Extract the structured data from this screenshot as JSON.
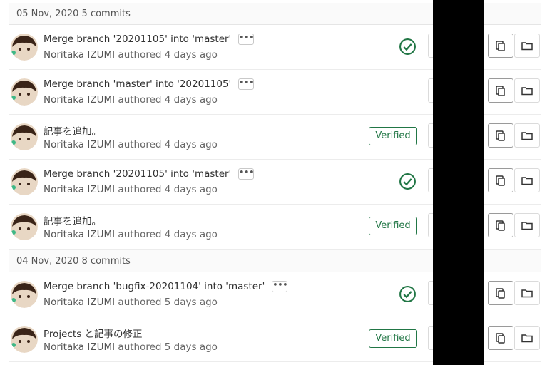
{
  "groups": [
    {
      "date_label": "05 Nov, 2020",
      "count_label": "5 commits"
    },
    {
      "date_label": "04 Nov, 2020",
      "count_label": "8 commits"
    }
  ],
  "commits": [
    {
      "title": "Merge branch '20201105' into 'master'",
      "author": "Noritaka IZUMI",
      "verb": "authored",
      "time": "4 days ago",
      "status": "check",
      "ellipsis": "•••"
    },
    {
      "title": "Merge branch 'master' into '20201105'",
      "author": "Noritaka IZUMI",
      "verb": "authored",
      "time": "4 days ago",
      "status": "none",
      "ellipsis": "•••"
    },
    {
      "title": "記事を追加。",
      "author": "Noritaka IZUMI",
      "verb": "authored",
      "time": "4 days ago",
      "status": "verified",
      "badge": "Verified"
    },
    {
      "title": "Merge branch '20201105' into 'master'",
      "author": "Noritaka IZUMI",
      "verb": "authored",
      "time": "4 days ago",
      "status": "check",
      "ellipsis": "•••"
    },
    {
      "title": "記事を追加。",
      "author": "Noritaka IZUMI",
      "verb": "authored",
      "time": "4 days ago",
      "status": "verified",
      "badge": "Verified"
    },
    {
      "title": "Merge branch 'bugfix-20201104' into 'master'",
      "author": "Noritaka IZUMI",
      "verb": "authored",
      "time": "5 days ago",
      "status": "check",
      "ellipsis": "•••"
    },
    {
      "title": "Projects と記事の修正",
      "author": "Noritaka IZUMI",
      "verb": "authored",
      "time": "5 days ago",
      "status": "verified",
      "badge": "Verified"
    }
  ],
  "colors": {
    "success": "#217645",
    "border": "#e5e5e5"
  },
  "icons": {
    "status": "check-circle-icon",
    "copy": "clipboard-icon",
    "browse": "folder-icon"
  }
}
